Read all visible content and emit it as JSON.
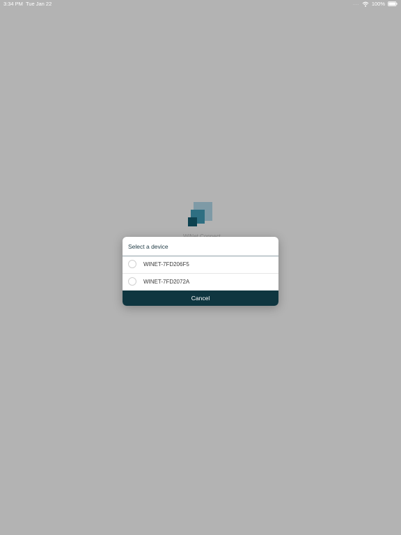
{
  "status_bar": {
    "time": "3:34 PM",
    "date": "Tue Jan 22",
    "signal": "....",
    "battery_percent": "100%",
    "battery_level": 1.0
  },
  "logo": {
    "caption": "WiNet Connect",
    "colors": {
      "back": "#7e9aa6",
      "middle": "#2e6f82",
      "front": "#0d4250"
    }
  },
  "dialog": {
    "title": "Select a device",
    "devices": [
      {
        "label": "WINET-7FD206F5",
        "selected": false
      },
      {
        "label": "WINET-7FD2072A",
        "selected": false
      }
    ],
    "cancel_label": "Cancel",
    "accent_color": "#0f3640"
  },
  "icons": {
    "wifi": "wifi-icon",
    "battery": "battery-icon",
    "radio": "radio-button-icon"
  }
}
